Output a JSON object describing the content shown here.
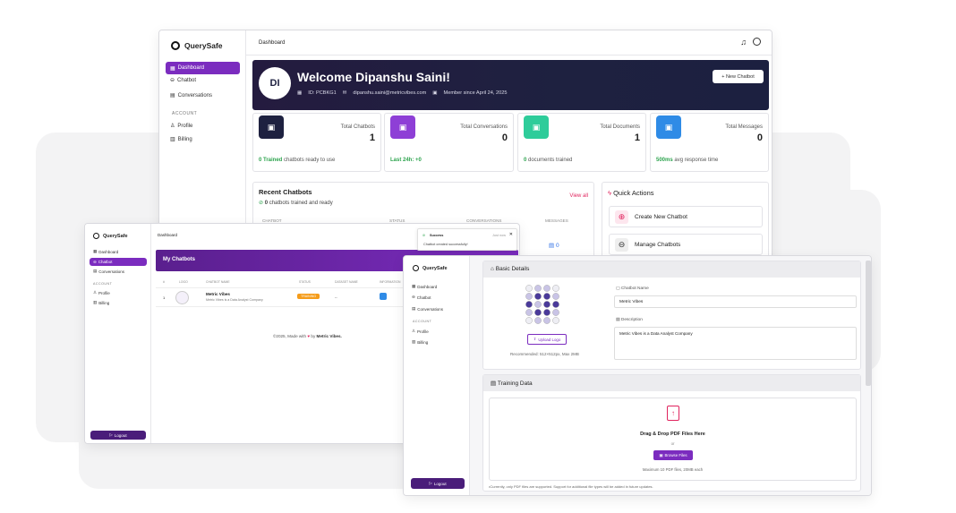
{
  "app": {
    "name": "QuerySafe"
  },
  "nav": {
    "dashboard": "Dashboard",
    "chatbot": "Chatbot",
    "conversations": "Conversations",
    "account": "ACCOUNT",
    "profile": "Profile",
    "billing": "Billing",
    "logout": "Logout"
  },
  "dash": {
    "breadcrumb": "Dashboard",
    "welcome": {
      "initials": "DI",
      "title": "Welcome Dipanshu Saini!",
      "id": "ID: PCBKG1",
      "email": "dipanshu.saini@metricvibes.com",
      "member": "Member since April 24, 2025",
      "new_btn": "+ New Chatbot"
    },
    "stats": [
      {
        "label": "Total Chatbots",
        "value": "1",
        "foot_hl": "0 Trained",
        "foot": " chatbots ready to use",
        "color": "#1e2140"
      },
      {
        "label": "Total Conversations",
        "value": "0",
        "foot_hl": "Last 24h: +0",
        "foot": "",
        "color": "#8e3fd6"
      },
      {
        "label": "Total Documents",
        "value": "1",
        "foot_hl": "0",
        "foot": " documents trained",
        "color": "#2ecc9a"
      },
      {
        "label": "Total Messages",
        "value": "0",
        "foot_hl": "500ms",
        "foot": " avg response time",
        "color": "#2f8be6"
      }
    ],
    "recent": {
      "title": "Recent Chatbots",
      "sub_hl": "0",
      "sub": " chatbots trained and ready",
      "view_all": "View all",
      "cols": [
        "CHATBOT",
        "STATUS",
        "CONVERSATIONS",
        "MESSAGES"
      ],
      "msg_val": "0"
    },
    "quick": {
      "title": "Quick Actions",
      "items": [
        "Create New Chatbot",
        "Manage Chatbots"
      ]
    }
  },
  "mybots": {
    "breadcrumb": "Dashboard",
    "title": "My Chatbots",
    "toast": {
      "title": "Success",
      "time": "Just now",
      "msg": "Chatbot created successfully!"
    },
    "cols": [
      "#",
      "LOGO",
      "CHATBOT NAME",
      "STATUS",
      "DATASET NAME",
      "INFORMATION"
    ],
    "row": {
      "num": "1",
      "name": "Metric Vibes",
      "desc": "Metric Vibes is a Data Analyst Company",
      "status": "TRAINING",
      "dataset": "--"
    },
    "footer_a": "©2025, Made with",
    "footer_b": "by",
    "footer_c": "Metric Vibes."
  },
  "form": {
    "basic": "Basic Details",
    "upload": "Upload Logo",
    "rec": "Recommended: 512×512px, Max 2MB",
    "name_label": "Chatbot Name",
    "name_val": "Metric Vibes",
    "desc_label": "Description",
    "desc_val": "Metric Vibes is a Data Analyst Company",
    "training": "Training Data",
    "drag": "Drag & Drop PDF Files Here",
    "or": "or",
    "browse": "Browse Files",
    "max": "Maximum 10 PDF files, 20MB each",
    "note": "•Currently, only PDF files are supported. Support for additional file types will be added in future updates."
  },
  "colors": {
    "purple": "#7b2cbf",
    "navy": "#1e2140",
    "green": "#2ea44f",
    "red": "#e0245e"
  }
}
